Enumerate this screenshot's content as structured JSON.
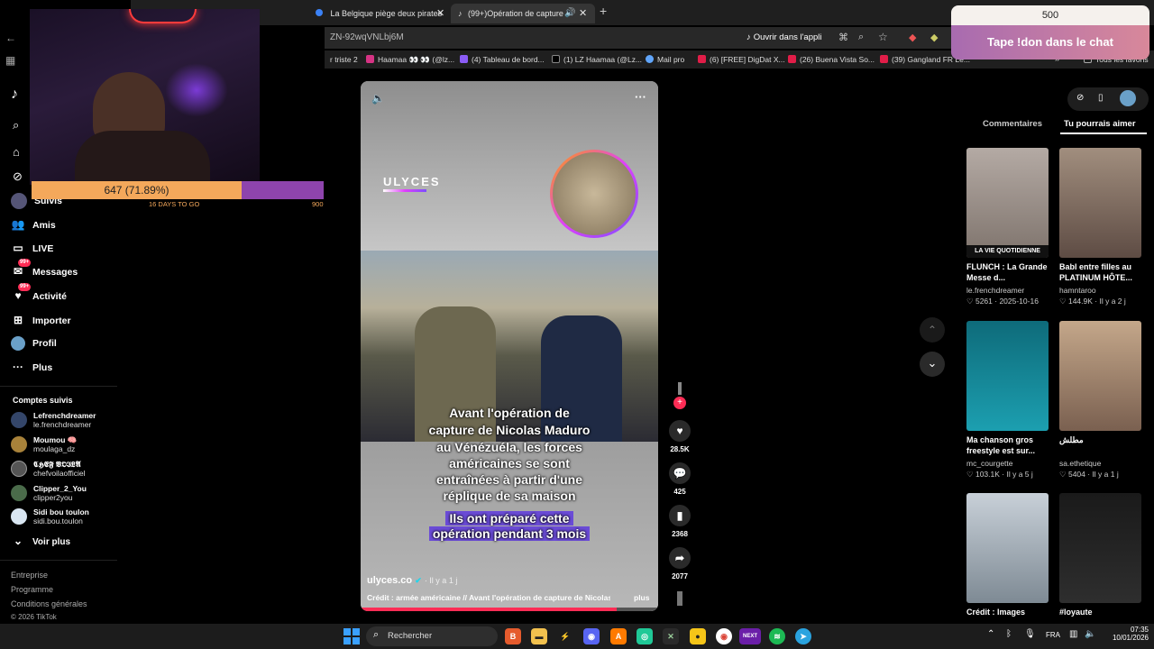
{
  "browser": {
    "tabs": [
      {
        "label": "La Belgique piège deux pirates"
      },
      {
        "label": "(99+)Opération de capture"
      }
    ],
    "address_fragment": "ZN-92wqVNLbj6M",
    "open_app_label": "Ouvrir dans l'appli",
    "bookmarks": [
      {
        "label": "r triste 2"
      },
      {
        "label": "Haamaa 👀 👀 (@lz..."
      },
      {
        "label": "(4) Tableau de bord..."
      },
      {
        "label": "(1) LZ Haamaa (@Lz..."
      },
      {
        "label": "Mail pro"
      },
      {
        "label": "(6) [FREE] DigDat X..."
      },
      {
        "label": "(26) Buena Vista So..."
      },
      {
        "label": "(39) Gangland FR Le..."
      }
    ],
    "all_bookmarks_label": "Tous les favoris"
  },
  "overlay": {
    "goal_current_text": "647 (71.89%)",
    "goal_fraction": 0.7189,
    "goal_days": "16 DAYS TO GO",
    "goal_target": "900",
    "don_count": "500",
    "don_label": "Tape !don dans le chat"
  },
  "sidebar": {
    "nav": [
      {
        "label": "Suivis"
      },
      {
        "label": "Amis"
      },
      {
        "label": "LIVE"
      },
      {
        "label": "Messages",
        "badge": "99+"
      },
      {
        "label": "Activité",
        "badge": "99+"
      },
      {
        "label": "Importer"
      },
      {
        "label": "Profil"
      },
      {
        "label": "Plus"
      }
    ],
    "following_title": "Comptes suivis",
    "accounts": [
      {
        "name": "Lefrenchdreamer",
        "handle": "le.frenchdreamer"
      },
      {
        "name": "Moumou 🧠",
        "handle": "moulaga_dz"
      },
      {
        "name": "𝕮𝕳𝕰𝕱 𝖁𝕺𝕴𝕷𝕬",
        "handle": "chefvoilaofficiel"
      },
      {
        "name": "Clipper_2_You",
        "handle": "clipper2you"
      },
      {
        "name": "Sidi bou toulon",
        "handle": "sidi.bou.toulon"
      }
    ],
    "see_more": "Voir plus",
    "footer": [
      "Entreprise",
      "Programme",
      "Conditions générales",
      "© 2026 TikTok"
    ]
  },
  "video": {
    "brand": "ULYCES",
    "caption_lines": [
      "Avant l'opération de",
      "capture de Nicolas Maduro",
      "au Vénézuéla, les forces",
      "américaines se sont",
      "entraînées à partir d'une",
      "réplique de sa maison"
    ],
    "highlight_lines": [
      "Ils ont préparé cette",
      "opération pendant 3 mois"
    ],
    "author": "ulyces.co",
    "time": "· Il y a 1 j",
    "description": "Crédit : armée américaine // Avant l'opération de capture de Nicolas",
    "more": "plus",
    "likes": "28.5K",
    "comments": "425",
    "saves": "2368",
    "shares": "2077"
  },
  "right_panel": {
    "tab_comments": "Commentaires",
    "tab_recommended": "Tu pourrais aimer",
    "cards": [
      {
        "title": "FLUNCH : La Grande Messe d...",
        "author": "le.frenchdreamer",
        "meta": "♡ 5261 · 2025-10-16",
        "thumb_text": "LA VIE QUOTIDIENNE"
      },
      {
        "title": "Babl entre filles au PLATINUM HÔTE...",
        "author": "hamntaroo",
        "meta": "♡ 144.9K · Il y a 2 j",
        "thumb_text": ""
      },
      {
        "title": "Ma chanson gros freestyle est sur...",
        "author": "mc_courgette",
        "meta": "♡ 103.1K · Il y a 5 j",
        "thumb_text": ""
      },
      {
        "title": "مطلش",
        "author": "sa.ethetique",
        "meta": "♡ 5404 · Il y a 1 j",
        "thumb_text": ""
      },
      {
        "title": "Crédit : Images",
        "author": "",
        "meta": "",
        "thumb_text": ""
      },
      {
        "title": "#loyaute",
        "author": "",
        "meta": "",
        "thumb_text": ""
      }
    ]
  },
  "taskbar": {
    "search_label": "Rechercher",
    "language": "FRA",
    "time": "07:35",
    "date": "10/01/2026"
  }
}
